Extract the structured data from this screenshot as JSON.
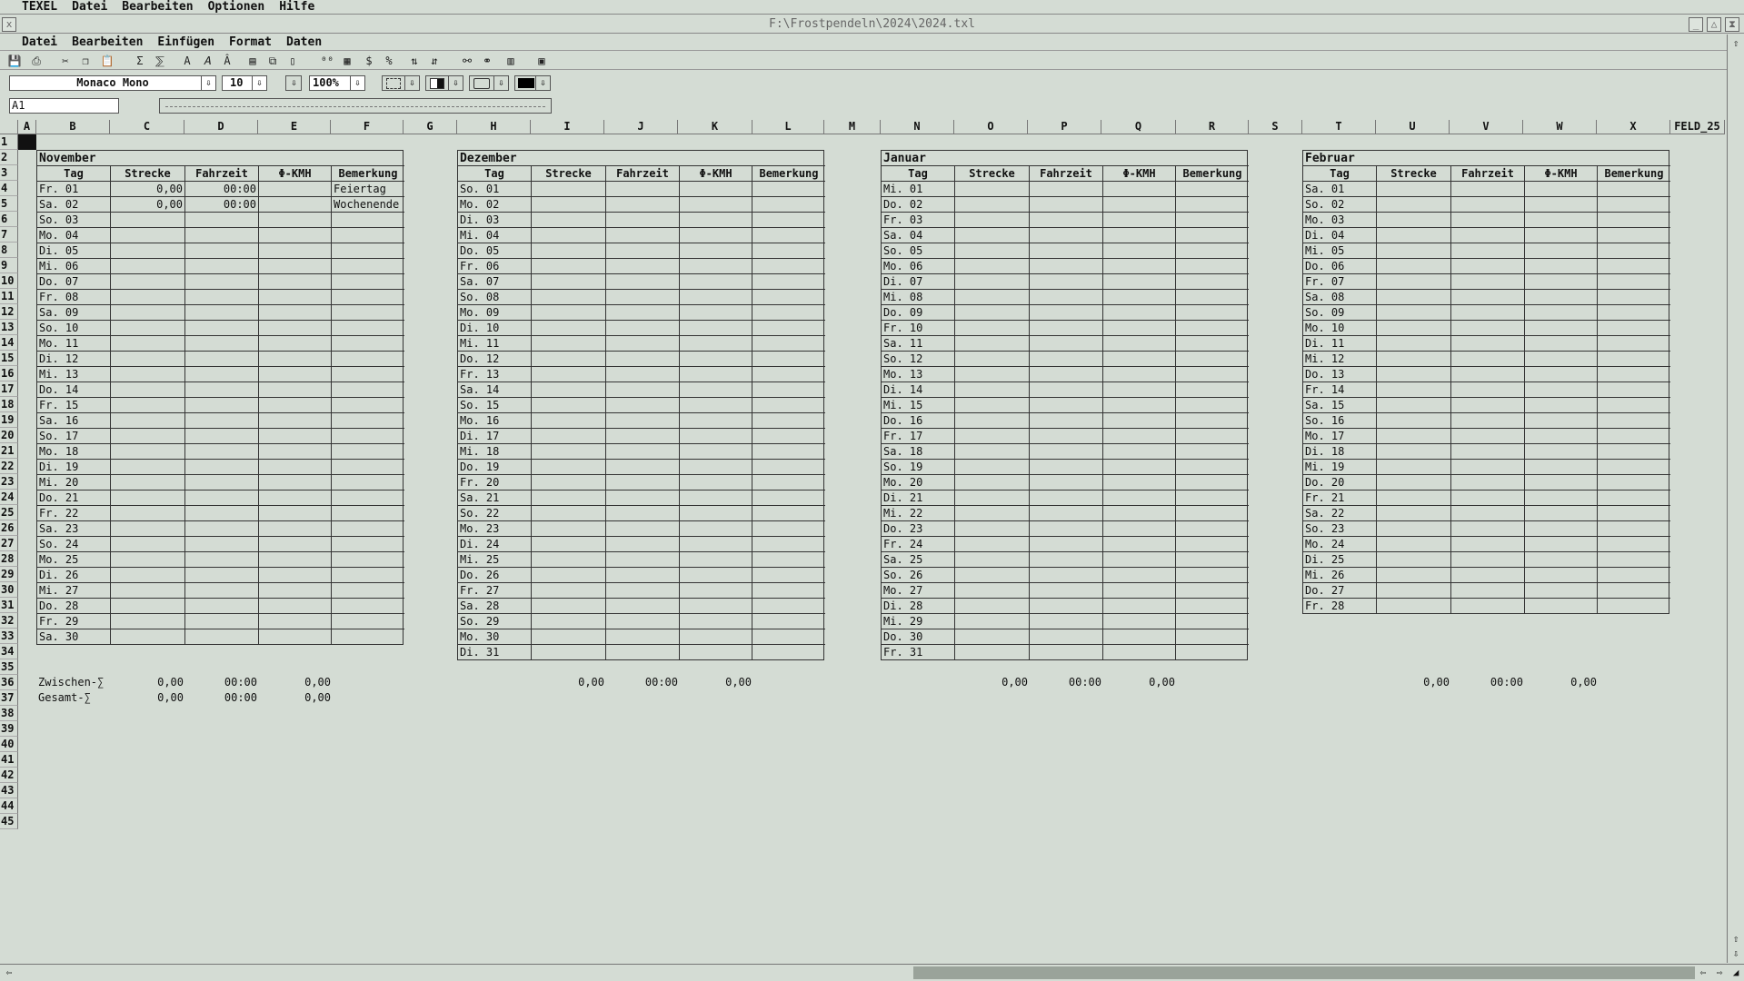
{
  "menubar": [
    "TEXEL",
    "Datei",
    "Bearbeiten",
    "Optionen",
    "Hilfe"
  ],
  "window": {
    "title": "F:\\Frostpendeln\\2024\\2024.txl",
    "close_glyph": "x",
    "min_glyph": "_",
    "max_glyph": "△",
    "full_glyph": "⧗"
  },
  "appmenu": [
    "Datei",
    "Bearbeiten",
    "Einfügen",
    "Format",
    "Daten"
  ],
  "toolbar_icons": [
    "save-icon",
    "print-icon",
    "cut-icon",
    "copy-icon",
    "paste-icon",
    "sum-icon",
    "autosum-icon",
    "font-icon",
    "font-style-icon",
    "font-color-icon",
    "insert-icon",
    "copy-format-icon",
    "page-icon",
    "decimal-icon",
    "calculator-icon",
    "currency-icon",
    "percent-icon",
    "sort-ascending-icon",
    "sort-descending-icon",
    "chart-icon",
    "chart2-icon",
    "book-icon",
    "window-icon"
  ],
  "format": {
    "font": "Monaco Mono",
    "size": "10",
    "zoom": "100%"
  },
  "cell_ref": "A1",
  "columns": [
    "A",
    "B",
    "C",
    "D",
    "E",
    "F",
    "G",
    "H",
    "I",
    "J",
    "K",
    "L",
    "M",
    "N",
    "O",
    "P",
    "Q",
    "R",
    "S",
    "T",
    "U",
    "V",
    "W",
    "X",
    "FELD_25"
  ],
  "rows": [
    "1",
    "2",
    "3",
    "4",
    "5",
    "6",
    "7",
    "8",
    "9",
    "10",
    "11",
    "12",
    "13",
    "14",
    "15",
    "16",
    "17",
    "18",
    "19",
    "20",
    "21",
    "22",
    "23",
    "24",
    "25",
    "26",
    "27",
    "28",
    "29",
    "30",
    "31",
    "32",
    "33",
    "34",
    "35",
    "36",
    "37",
    "38",
    "39",
    "40",
    "41",
    "42",
    "43",
    "44",
    "45"
  ],
  "headers": [
    "Tag",
    "Strecke",
    "Fahrzeit",
    "Φ-KMH",
    "Bemerkung"
  ],
  "months": [
    {
      "name": "November",
      "days": [
        "Fr. 01",
        "Sa. 02",
        "So. 03",
        "Mo. 04",
        "Di. 05",
        "Mi. 06",
        "Do. 07",
        "Fr. 08",
        "Sa. 09",
        "So. 10",
        "Mo. 11",
        "Di. 12",
        "Mi. 13",
        "Do. 14",
        "Fr. 15",
        "Sa. 16",
        "So. 17",
        "Mo. 18",
        "Di. 19",
        "Mi. 20",
        "Do. 21",
        "Fr. 22",
        "Sa. 23",
        "So. 24",
        "Mo. 25",
        "Di. 26",
        "Mi. 27",
        "Do. 28",
        "Fr. 29",
        "Sa. 30"
      ],
      "filled": [
        {
          "strecke": "0,00",
          "fahrzeit": "00:00",
          "bemerkung": "Feiertag"
        },
        {
          "strecke": "0,00",
          "fahrzeit": "00:00",
          "bemerkung": "Wochenende"
        }
      ],
      "zwischen": [
        "0,00",
        "00:00",
        "0,00"
      ],
      "gesamt": [
        "0,00",
        "00:00",
        "0,00"
      ]
    },
    {
      "name": "Dezember",
      "days": [
        "So. 01",
        "Mo. 02",
        "Di. 03",
        "Mi. 04",
        "Do. 05",
        "Fr. 06",
        "Sa. 07",
        "So. 08",
        "Mo. 09",
        "Di. 10",
        "Mi. 11",
        "Do. 12",
        "Fr. 13",
        "Sa. 14",
        "So. 15",
        "Mo. 16",
        "Di. 17",
        "Mi. 18",
        "Do. 19",
        "Fr. 20",
        "Sa. 21",
        "So. 22",
        "Mo. 23",
        "Di. 24",
        "Mi. 25",
        "Do. 26",
        "Fr. 27",
        "Sa. 28",
        "So. 29",
        "Mo. 30",
        "Di. 31"
      ],
      "zwischen": [
        "0,00",
        "00:00",
        "0,00"
      ]
    },
    {
      "name": "Januar",
      "days": [
        "Mi. 01",
        "Do. 02",
        "Fr. 03",
        "Sa. 04",
        "So. 05",
        "Mo. 06",
        "Di. 07",
        "Mi. 08",
        "Do. 09",
        "Fr. 10",
        "Sa. 11",
        "So. 12",
        "Mo. 13",
        "Di. 14",
        "Mi. 15",
        "Do. 16",
        "Fr. 17",
        "Sa. 18",
        "So. 19",
        "Mo. 20",
        "Di. 21",
        "Mi. 22",
        "Do. 23",
        "Fr. 24",
        "Sa. 25",
        "So. 26",
        "Mo. 27",
        "Di. 28",
        "Mi. 29",
        "Do. 30",
        "Fr. 31"
      ],
      "zwischen": [
        "0,00",
        "00:00",
        "0,00"
      ]
    },
    {
      "name": "Februar",
      "days": [
        "Sa. 01",
        "So. 02",
        "Mo. 03",
        "Di. 04",
        "Mi. 05",
        "Do. 06",
        "Fr. 07",
        "Sa. 08",
        "So. 09",
        "Mo. 10",
        "Di. 11",
        "Mi. 12",
        "Do. 13",
        "Fr. 14",
        "Sa. 15",
        "So. 16",
        "Mo. 17",
        "Di. 18",
        "Mi. 19",
        "Do. 20",
        "Fr. 21",
        "Sa. 22",
        "So. 23",
        "Mo. 24",
        "Di. 25",
        "Mi. 26",
        "Do. 27",
        "Fr. 28"
      ],
      "zwischen": [
        "0,00",
        "00:00",
        "0,00"
      ]
    }
  ],
  "labels": {
    "zwischen": "Zwischen-∑",
    "gesamt": "Gesamt-∑"
  },
  "scroll": {
    "up": "⇧",
    "down": "⇩",
    "left": "⇦",
    "right": "⇨",
    "corner": "◢"
  }
}
